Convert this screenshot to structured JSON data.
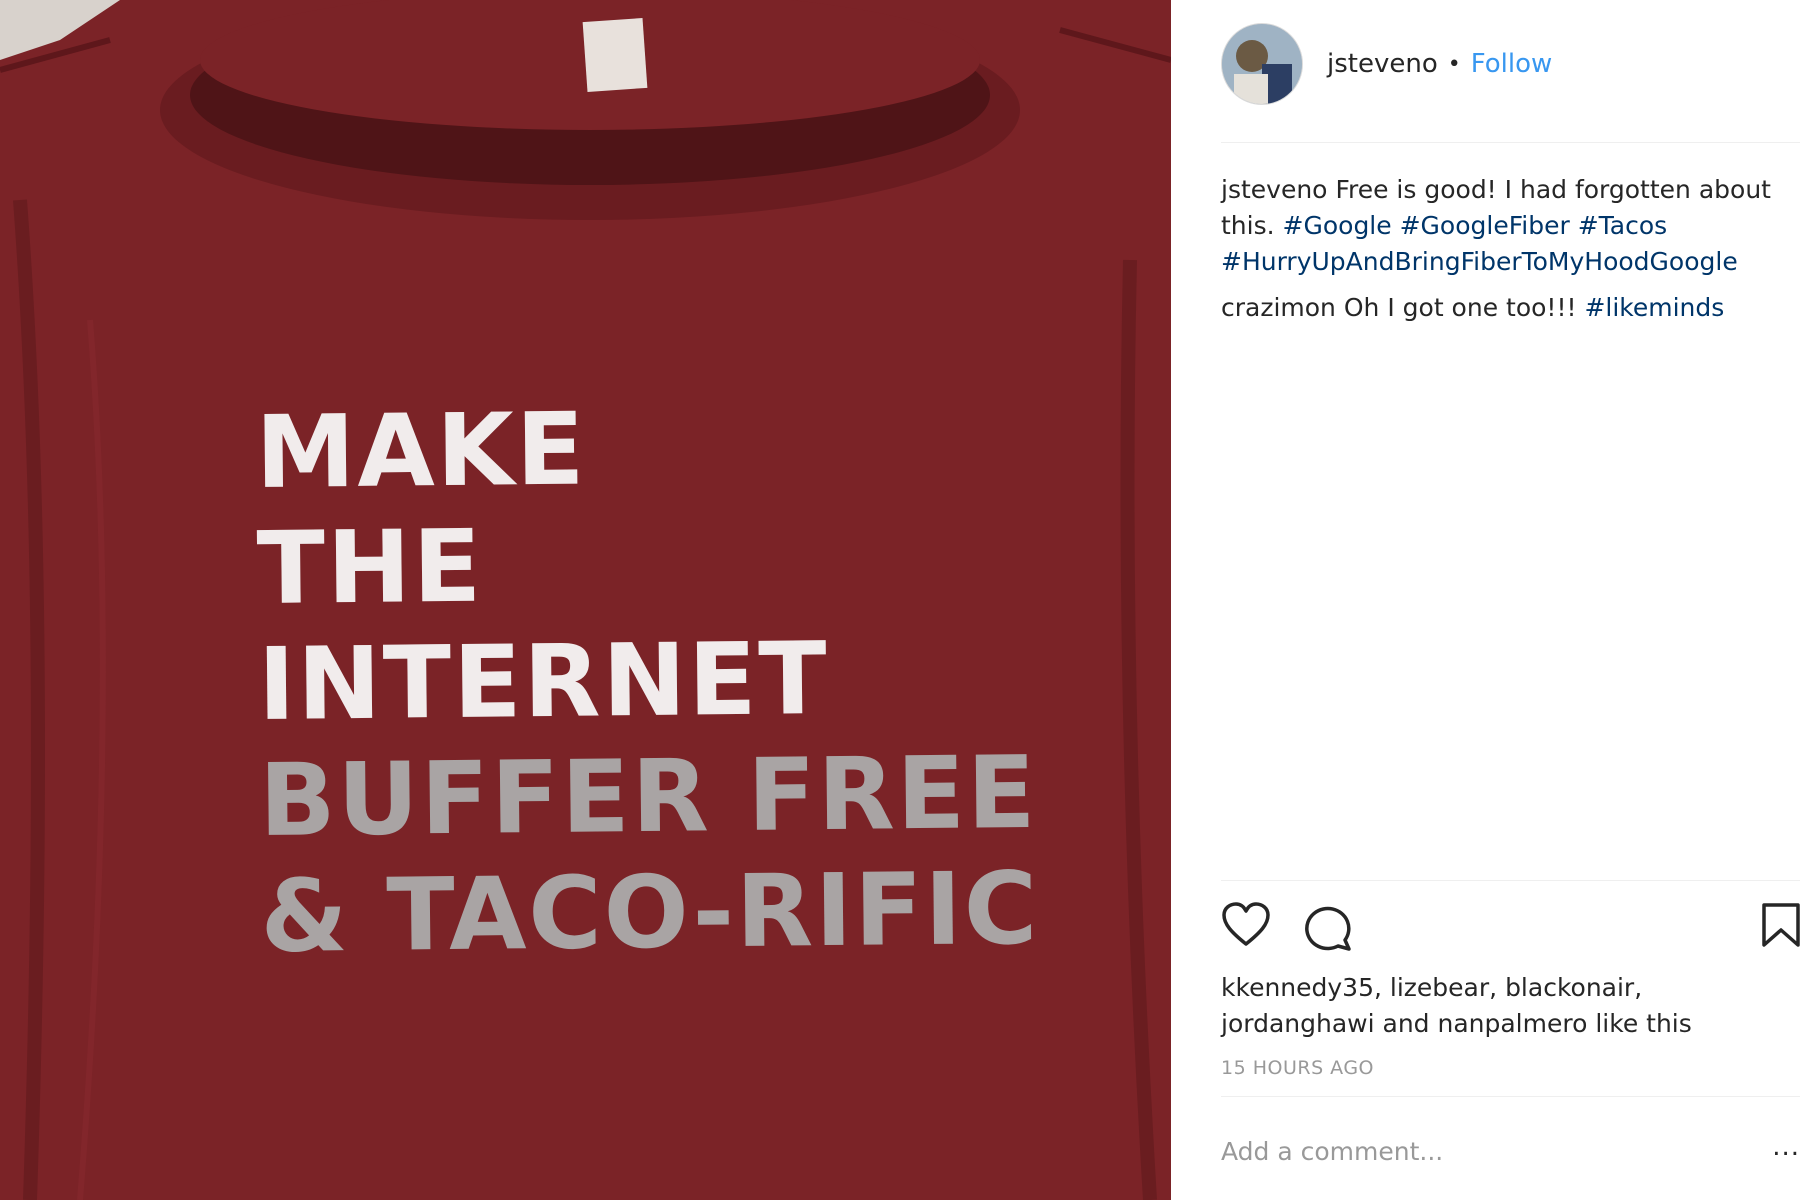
{
  "post": {
    "shirt_lines": [
      {
        "text": "MAKE",
        "tone": "white"
      },
      {
        "text": "THE",
        "tone": "white"
      },
      {
        "text": "INTERNET",
        "tone": "white"
      },
      {
        "text": "BUFFER FREE",
        "tone": "gray"
      },
      {
        "text": "& TACO-RIFIC",
        "tone": "gray"
      }
    ],
    "shirt_color": "#7a2226"
  },
  "header": {
    "username": "jsteveno",
    "separator": "•",
    "follow_label": "Follow"
  },
  "comments": [
    {
      "user": "jsteveno",
      "text": "Free is good! I had forgotten about this.",
      "hashtags": [
        "#Google",
        "#GoogleFiber",
        "#Tacos",
        "#HurryUpAndBringFiberToMyHoodGoogle"
      ]
    },
    {
      "user": "crazimon",
      "text": "Oh I got one too!!!",
      "hashtags": [
        "#likeminds"
      ]
    }
  ],
  "actions": {
    "like_icon": "heart-icon",
    "comment_icon": "comment-bubble-icon",
    "save_icon": "bookmark-icon"
  },
  "likes": {
    "users": [
      "kkennedy35",
      "lizebear",
      "blackonair",
      "jordanghawi",
      "nanpalmero"
    ],
    "suffix": "like this"
  },
  "timestamp": "15 HOURS AGO",
  "add_comment": {
    "placeholder": "Add a comment...",
    "more_label": "..."
  },
  "colors": {
    "link_blue": "#3897f0",
    "hashtag": "#003569",
    "muted": "#999999"
  }
}
